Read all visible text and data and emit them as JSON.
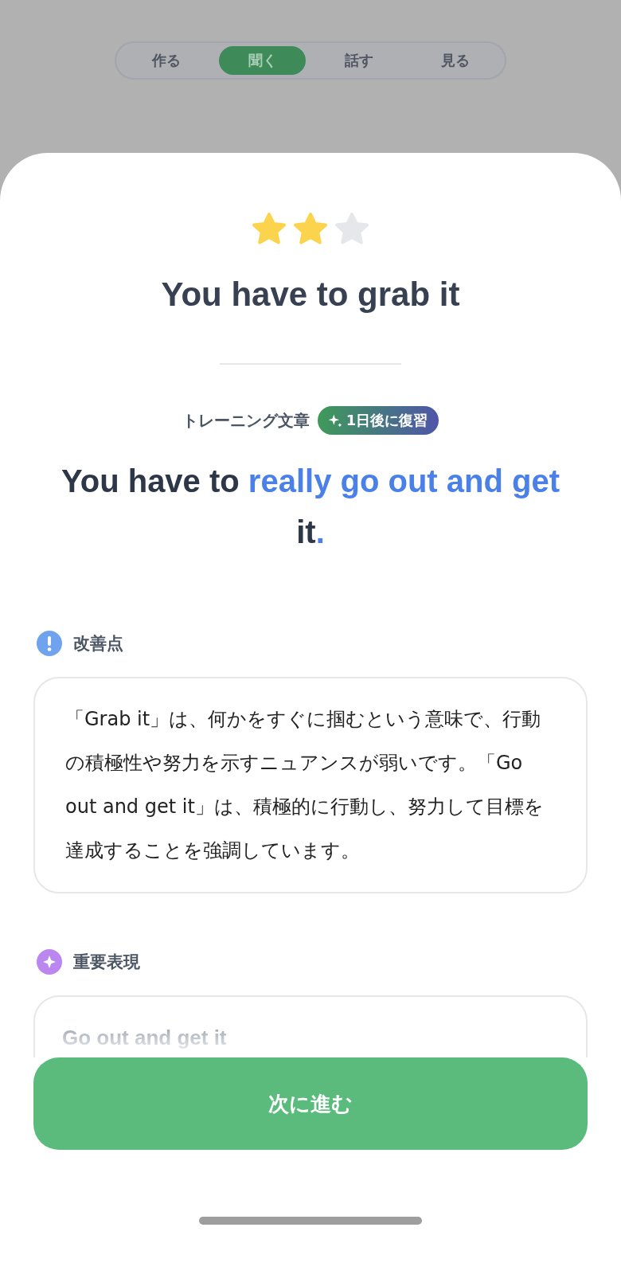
{
  "tabs": [
    {
      "label": "作る",
      "selected": false
    },
    {
      "label": "聞く",
      "selected": true
    },
    {
      "label": "話す",
      "selected": false
    },
    {
      "label": "見る",
      "selected": false
    }
  ],
  "result": {
    "stars": 2,
    "title": "You have to grab it"
  },
  "training": {
    "label": "トレーニング文章",
    "badge": "1日後に復習",
    "sentence": [
      {
        "text": "You have to ",
        "highlight": false
      },
      {
        "text": "really go out and get",
        "highlight": true
      },
      {
        "text": " it",
        "highlight": false
      },
      {
        "text": ".",
        "highlight": true
      }
    ]
  },
  "sections": [
    {
      "kind": "improvement",
      "title": "改善点",
      "body": "「Grab it」は、何かをすぐに掴むという意味で、行動の積極性や努力を示すニュアンスが弱いです。「Go out and get it」は、積極的に行動し、努力して目標を達成することを強調しています。"
    },
    {
      "kind": "expression",
      "title": "重要表現",
      "body": "Go out and get it"
    }
  ],
  "next_button": "次に進む"
}
